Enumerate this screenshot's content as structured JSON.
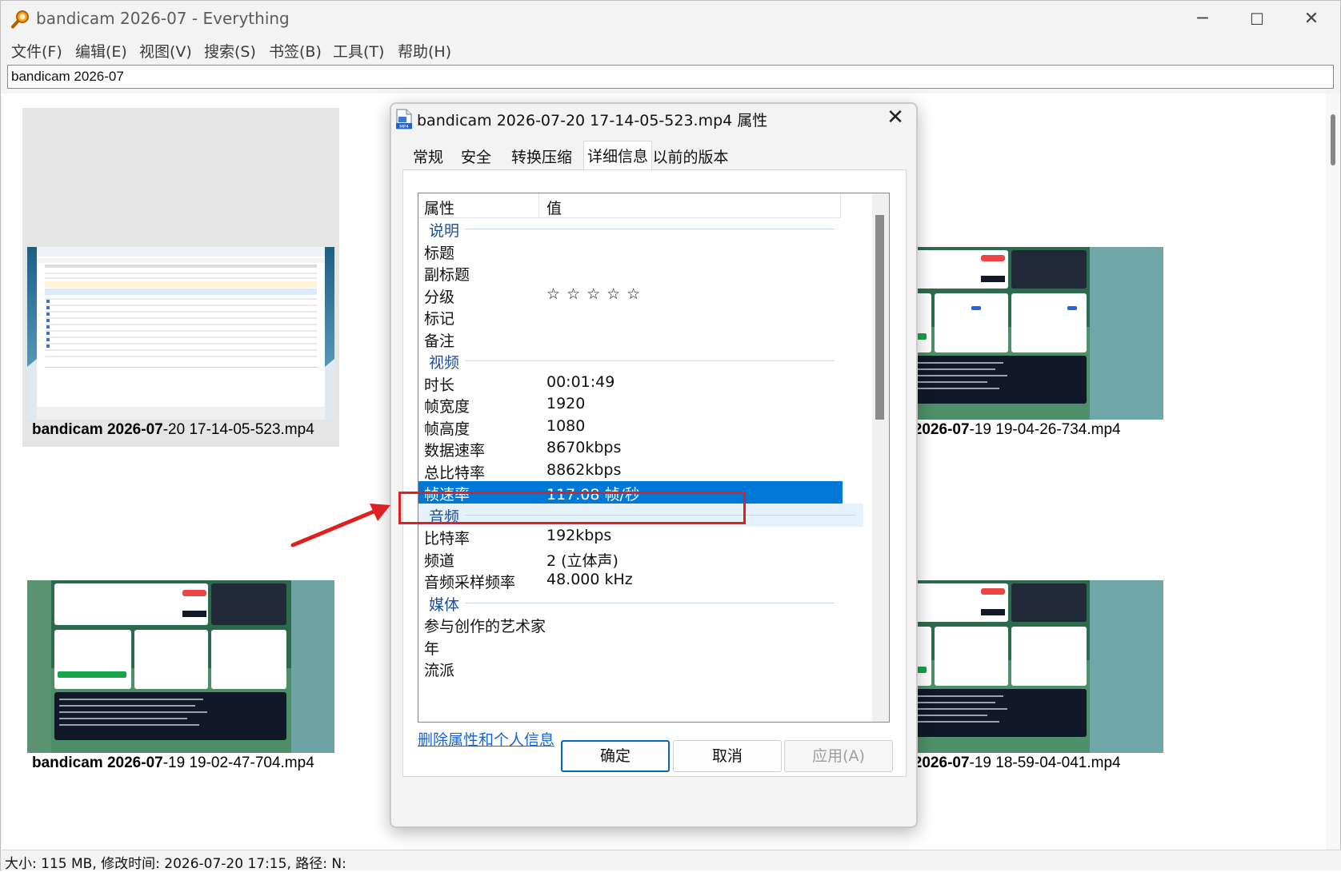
{
  "window": {
    "title": "bandicam 2026-07 - Everything",
    "controls": {
      "minimize": "─",
      "maximize": "☐",
      "close": "✕"
    }
  },
  "menu": [
    "文件(F)",
    "编辑(E)",
    "视图(V)",
    "搜索(S)",
    "书签(B)",
    "工具(T)",
    "帮助(H)"
  ],
  "search": {
    "value": "bandicam 2026-07"
  },
  "results": [
    {
      "prefix": "bandicam 2026-07",
      "suffix": "-20 17-14-05-523.mp4",
      "selected": true
    },
    {
      "prefix": "bandicam 2026-07",
      "suffix": "-19 19-04-26-734.mp4",
      "lead": "ndicam 2026-07"
    },
    {
      "prefix": "bandicam 2026-07",
      "suffix": "-19 19-02-47-704.mp4"
    },
    {
      "prefix": "bandicam 2026-07",
      "suffix": "-19 18-59-04-041.mp4",
      "lead": "ndicam 2026-07"
    }
  ],
  "status": {
    "text": "大小: 115 MB, 修改时间: 2026-07-20 17:15, 路径: N:"
  },
  "dialog": {
    "title": "bandicam 2026-07-20 17-14-05-523.mp4 属性",
    "icon_label": "MP4",
    "close": "✕",
    "tabs": [
      "常规",
      "安全",
      "转换压缩",
      "详细信息",
      "以前的版本"
    ],
    "active_tab": "详细信息",
    "columns": {
      "property": "属性",
      "value": "值"
    },
    "rows": [
      {
        "type": "group",
        "k": "说明"
      },
      {
        "k": "标题",
        "v": ""
      },
      {
        "k": "副标题",
        "v": ""
      },
      {
        "k": "分级",
        "v": "☆☆☆☆☆"
      },
      {
        "k": "标记",
        "v": ""
      },
      {
        "k": "备注",
        "v": ""
      },
      {
        "type": "group",
        "k": "视频"
      },
      {
        "k": "时长",
        "v": "00:01:49"
      },
      {
        "k": "帧宽度",
        "v": "1920"
      },
      {
        "k": "帧高度",
        "v": "1080"
      },
      {
        "k": "数据速率",
        "v": "8670kbps"
      },
      {
        "k": "总比特率",
        "v": "8862kbps"
      },
      {
        "k": "帧速率",
        "v": "117.08 帧/秒",
        "selected": true
      },
      {
        "type": "group",
        "k": "音频",
        "hover": true
      },
      {
        "k": "比特率",
        "v": "192kbps"
      },
      {
        "k": "频道",
        "v": "2 (立体声)"
      },
      {
        "k": "音频采样频率",
        "v": "48.000 kHz"
      },
      {
        "type": "group",
        "k": "媒体"
      },
      {
        "k": "参与创作的艺术家",
        "v": ""
      },
      {
        "k": "年",
        "v": ""
      },
      {
        "k": "流派",
        "v": ""
      }
    ],
    "remove_link": "删除属性和个人信息",
    "buttons": {
      "ok": "确定",
      "cancel": "取消",
      "apply": "应用(A)"
    }
  },
  "colors": {
    "selection": "#0078d7",
    "annotation": "#e02020",
    "link": "#1a64d4"
  }
}
